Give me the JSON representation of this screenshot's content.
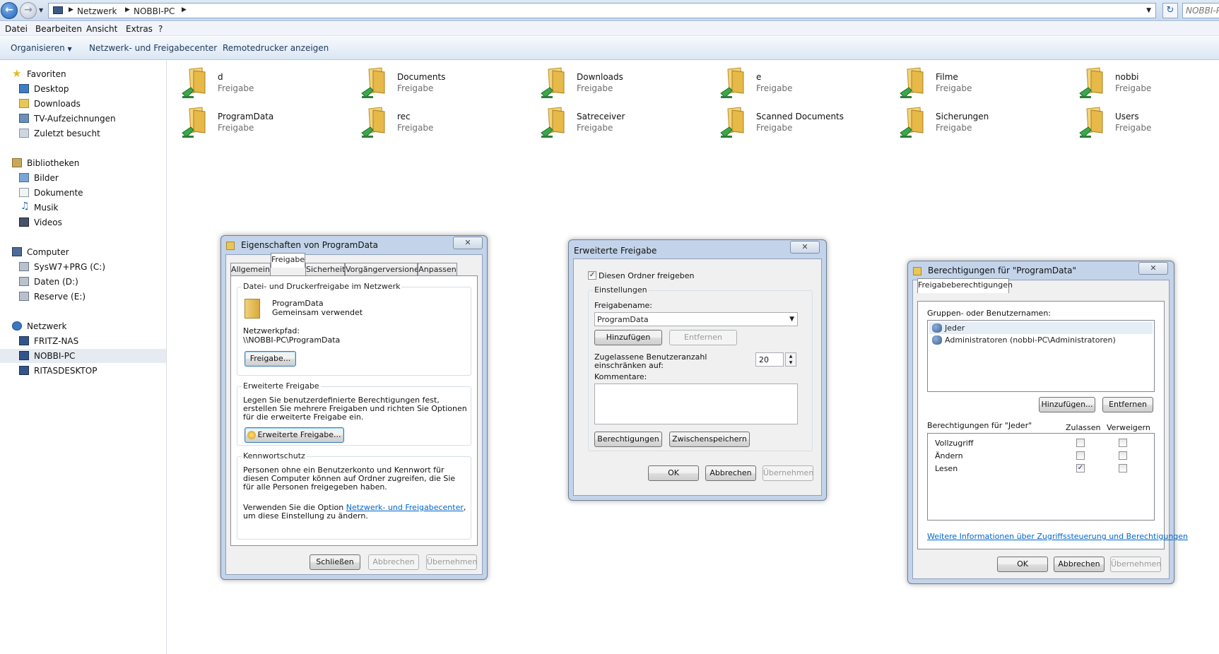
{
  "addressbar": {
    "crumbs": [
      "Netzwerk",
      "NOBBI-PC"
    ],
    "search_placeholder": "NOBBI-PC durchsuchen"
  },
  "menu": [
    "Datei",
    "Bearbeiten",
    "Ansicht",
    "Extras",
    "?"
  ],
  "toolbar": {
    "organize": "Organisieren",
    "network_center": "Netzwerk- und Freigabecenter",
    "remote_printers": "Remotedrucker anzeigen"
  },
  "nav": {
    "favorites": "Favoriten",
    "fav_items": [
      "Desktop",
      "Downloads",
      "TV-Aufzeichnungen",
      "Zuletzt besucht"
    ],
    "libraries": "Bibliotheken",
    "lib_items": [
      "Bilder",
      "Dokumente",
      "Musik",
      "Videos"
    ],
    "computer": "Computer",
    "computer_items": [
      "SysW7+PRG (C:)",
      "Daten (D:)",
      "Reserve (E:)"
    ],
    "network": "Netzwerk",
    "network_items": [
      "FRITZ-NAS",
      "NOBBI-PC",
      "RITASDESKTOP"
    ]
  },
  "shares": [
    {
      "name": "d",
      "sub": "Freigabe"
    },
    {
      "name": "Documents",
      "sub": "Freigabe"
    },
    {
      "name": "Downloads",
      "sub": "Freigabe"
    },
    {
      "name": "e",
      "sub": "Freigabe"
    },
    {
      "name": "Filme",
      "sub": "Freigabe"
    },
    {
      "name": "nobbi",
      "sub": "Freigabe"
    },
    {
      "name": "ProgramData",
      "sub": "Freigabe"
    },
    {
      "name": "rec",
      "sub": "Freigabe"
    },
    {
      "name": "Satreceiver",
      "sub": "Freigabe"
    },
    {
      "name": "Scanned Documents",
      "sub": "Freigabe"
    },
    {
      "name": "Sicherungen",
      "sub": "Freigabe"
    },
    {
      "name": "Users",
      "sub": "Freigabe"
    }
  ],
  "props": {
    "title": "Eigenschaften von ProgramData",
    "tabs": [
      "Allgemein",
      "Freigabe",
      "Sicherheit",
      "Vorgängerversionen",
      "Anpassen"
    ],
    "g1_label": "Datei- und Druckerfreigabe im Netzwerk",
    "folder_name": "ProgramData",
    "folder_status": "Gemeinsam verwendet",
    "netpath_label": "Netzwerkpfad:",
    "netpath": "\\\\NOBBI-PC\\ProgramData",
    "share_btn": "Freigabe...",
    "g2_label": "Erweiterte Freigabe",
    "g2_text": "Legen Sie benutzerdefinierte Berechtigungen fest, erstellen Sie mehrere Freigaben und richten Sie Optionen für die erweiterte Freigabe ein.",
    "adv_btn": "Erweiterte Freigabe...",
    "g3_label": "Kennwortschutz",
    "g3_text": "Personen ohne ein Benutzerkonto und Kennwort für diesen Computer können auf Ordner zugreifen, die Sie für alle Personen freigegeben haben.",
    "g3_text2_pre": "Verwenden Sie die Option ",
    "g3_link": "Netzwerk- und Freigabecenter",
    "g3_text2_post": ", um diese Einstellung zu ändern.",
    "close_btn": "Schließen",
    "cancel_btn": "Abbrechen",
    "apply_btn": "Übernehmen"
  },
  "adv": {
    "title": "Erweiterte Freigabe",
    "share_check": "Diesen Ordner freigeben",
    "settings_label": "Einstellungen",
    "sharename_label": "Freigabename:",
    "sharename": "ProgramData",
    "add_btn": "Hinzufügen",
    "remove_btn": "Entfernen",
    "limit_label": "Zugelassene Benutzeranzahl einschränken auf:",
    "limit_value": "20",
    "comment_label": "Kommentare:",
    "perm_btn": "Berechtigungen",
    "cache_btn": "Zwischenspeichern",
    "ok_btn": "OK",
    "cancel_btn": "Abbrechen",
    "apply_btn": "Übernehmen"
  },
  "perms": {
    "title": "Berechtigungen für \"ProgramData\"",
    "tab": "Freigabeberechtigungen",
    "groups_label": "Gruppen- oder Benutzernamen:",
    "users": [
      "Jeder",
      "Administratoren (nobbi-PC\\Administratoren)"
    ],
    "add_btn": "Hinzufügen...",
    "remove_btn": "Entfernen",
    "perm_for": "Berechtigungen für \"Jeder\"",
    "allow_col": "Zulassen",
    "deny_col": "Verweigern",
    "rows": [
      {
        "name": "Vollzugriff",
        "allow": false,
        "deny": false
      },
      {
        "name": "Ändern",
        "allow": false,
        "deny": false
      },
      {
        "name": "Lesen",
        "allow": true,
        "deny": false
      }
    ],
    "info_link": "Weitere Informationen über Zugriffssteuerung und Berechtigungen",
    "ok_btn": "OK",
    "cancel_btn": "Abbrechen",
    "apply_btn": "Übernehmen"
  }
}
